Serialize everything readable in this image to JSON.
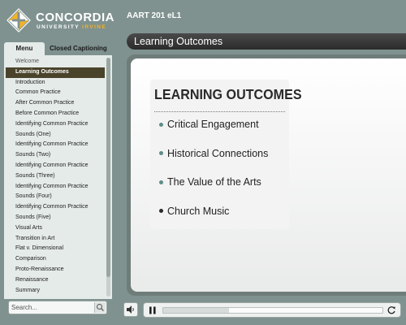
{
  "brand": {
    "name": "CONCORDIA",
    "sub_prefix": "UNIVERSITY",
    "sub_accent": "IRVINE"
  },
  "course": {
    "title": "AART 201 eL1"
  },
  "sidebar": {
    "tabs": [
      {
        "label": "Menu",
        "active": true
      },
      {
        "label": "Closed Captioning",
        "active": false
      }
    ],
    "items": [
      {
        "label": "Welcome"
      },
      {
        "label": "Learning Outcomes",
        "active": true
      },
      {
        "label": "Introduction"
      },
      {
        "label": "Common Practice"
      },
      {
        "label": "After Common Practice"
      },
      {
        "label": "Before Common Practice"
      },
      {
        "label": "Identifying Common Practice"
      },
      {
        "label": "Sounds (One)"
      },
      {
        "label": "Identifying Common Practice"
      },
      {
        "label": "Sounds (Two)"
      },
      {
        "label": "Identifying Common Practice"
      },
      {
        "label": "Sounds (Three)"
      },
      {
        "label": "Identifying Common Practice"
      },
      {
        "label": "Sounds (Four)"
      },
      {
        "label": "Identifying Common Practice"
      },
      {
        "label": "Sounds (Five)"
      },
      {
        "label": "Visual Arts"
      },
      {
        "label": "Transition in Art"
      },
      {
        "label": "Flat v. Dimensional"
      },
      {
        "label": "Comparison"
      },
      {
        "label": "Proto-Renaissance"
      },
      {
        "label": "Renaissance"
      },
      {
        "label": "Summary"
      }
    ],
    "search": {
      "placeholder": "Search...",
      "value": ""
    }
  },
  "slide": {
    "header_title": "Learning Outcomes",
    "heading": "LEARNING OUTCOMES",
    "outcomes": [
      "Critical Engagement",
      "Historical Connections",
      "The Value of the Arts",
      "Church Music"
    ]
  },
  "player": {
    "progress": 0.3
  },
  "colors": {
    "background": "#7f928f",
    "menu_active": "#4a432b",
    "bullet_teal": "#5f8c86",
    "bullet_dark": "#2a2a2a",
    "brand_accent": "#f3b229"
  }
}
